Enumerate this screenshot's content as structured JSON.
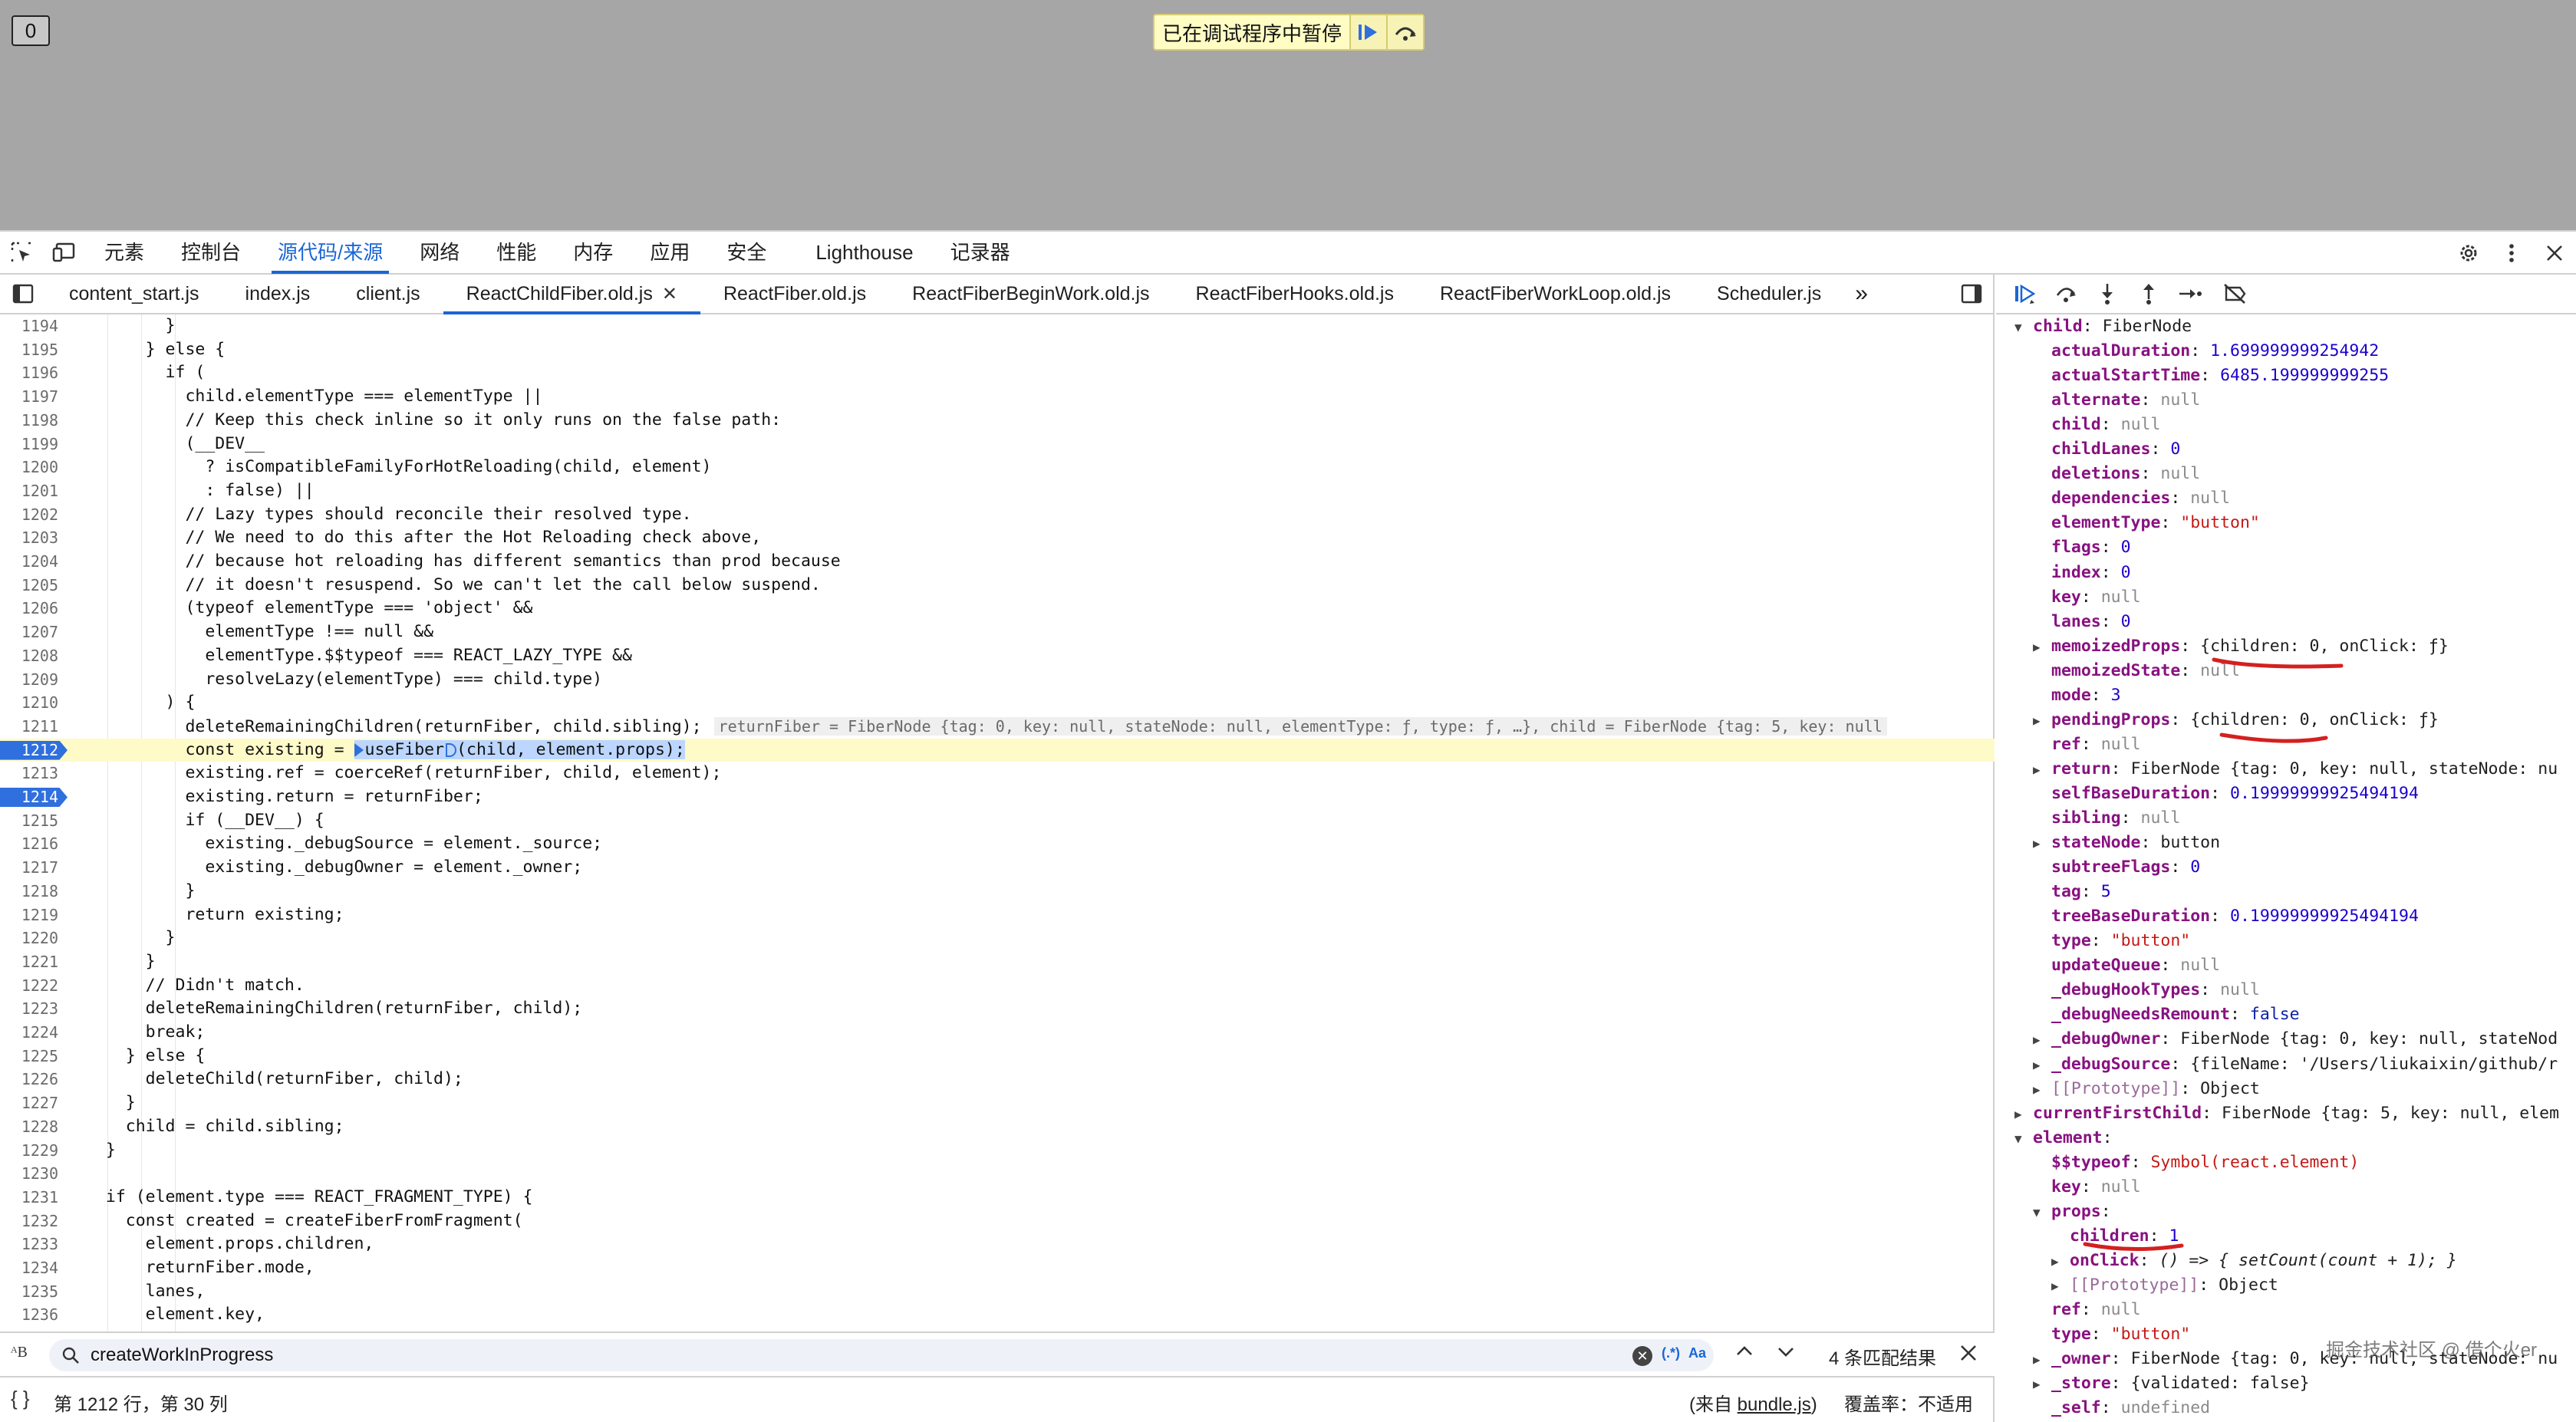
{
  "page": {
    "counter": "0",
    "paused_text": "已在调试程序中暂停"
  },
  "toolbar": {
    "tabs": [
      "元素",
      "控制台",
      "源代码/来源",
      "网络",
      "性能",
      "内存",
      "应用",
      "安全",
      "Lighthouse",
      "记录器"
    ],
    "active_tab": "源代码/来源"
  },
  "file_tabs": [
    "content_start.js",
    "index.js",
    "client.js",
    "ReactChildFiber.old.js",
    "ReactFiber.old.js",
    "ReactFiberBeginWork.old.js",
    "ReactFiberHooks.old.js",
    "ReactFiberWorkLoop.old.js",
    "Scheduler.js"
  ],
  "active_file": "ReactChildFiber.old.js",
  "code": {
    "lines": [
      {
        "n": "1194",
        "t": "        }"
      },
      {
        "n": "1195",
        "t": "      } else {"
      },
      {
        "n": "1196",
        "t": "        if ("
      },
      {
        "n": "1197",
        "t": "          child.elementType === elementType ||"
      },
      {
        "n": "1198",
        "t": "          // Keep this check inline so it only runs on the false path:"
      },
      {
        "n": "1199",
        "t": "          (__DEV__"
      },
      {
        "n": "1200",
        "t": "            ? isCompatibleFamilyForHotReloading(child, element)"
      },
      {
        "n": "1201",
        "t": "            : false) ||"
      },
      {
        "n": "1202",
        "t": "          // Lazy types should reconcile their resolved type."
      },
      {
        "n": "1203",
        "t": "          // We need to do this after the Hot Reloading check above,"
      },
      {
        "n": "1204",
        "t": "          // because hot reloading has different semantics than prod because"
      },
      {
        "n": "1205",
        "t": "          // it doesn't resuspend. So we can't let the call below suspend."
      },
      {
        "n": "1206",
        "t": "          (typeof elementType === 'object' &&"
      },
      {
        "n": "1207",
        "t": "            elementType !== null &&"
      },
      {
        "n": "1208",
        "t": "            elementType.$$typeof === REACT_LAZY_TYPE &&"
      },
      {
        "n": "1209",
        "t": "            resolveLazy(elementType) === child.type)"
      },
      {
        "n": "1210",
        "t": "        ) {"
      },
      {
        "n": "1211",
        "t": "          deleteRemainingChildren(returnFiber, child.sibling);"
      },
      {
        "n": "1212",
        "t": "          const existing = "
      },
      {
        "n": "1213",
        "t": "          existing.ref = coerceRef(returnFiber, child, element);"
      },
      {
        "n": "1214",
        "t": "          existing.return = returnFiber;"
      },
      {
        "n": "1215",
        "t": "          if (__DEV__) {"
      },
      {
        "n": "1216",
        "t": "            existing._debugSource = element._source;"
      },
      {
        "n": "1217",
        "t": "            existing._debugOwner = element._owner;"
      },
      {
        "n": "1218",
        "t": "          }"
      },
      {
        "n": "1219",
        "t": "          return existing;"
      },
      {
        "n": "1220",
        "t": "        }"
      },
      {
        "n": "1221",
        "t": "      }"
      },
      {
        "n": "1222",
        "t": "      // Didn't match."
      },
      {
        "n": "1223",
        "t": "      deleteRemainingChildren(returnFiber, child);"
      },
      {
        "n": "1224",
        "t": "      break;"
      },
      {
        "n": "1225",
        "t": "    } else {"
      },
      {
        "n": "1226",
        "t": "      deleteChild(returnFiber, child);"
      },
      {
        "n": "1227",
        "t": "    }"
      },
      {
        "n": "1228",
        "t": "    child = child.sibling;"
      },
      {
        "n": "1229",
        "t": "  }"
      },
      {
        "n": "1230",
        "t": ""
      },
      {
        "n": "1231",
        "t": "  if (element.type === REACT_FRAGMENT_TYPE) {"
      },
      {
        "n": "1232",
        "t": "    const created = createFiberFromFragment("
      },
      {
        "n": "1233",
        "t": "      element.props.children,"
      },
      {
        "n": "1234",
        "t": "      returnFiber.mode,"
      },
      {
        "n": "1235",
        "t": "      lanes,"
      },
      {
        "n": "1236",
        "t": "      element.key,"
      }
    ],
    "line_1212_rest": "useFiber",
    "line_1212_tail": "(child, element.props);",
    "inline_value_1211": "returnFiber = FiberNode {tag: 0, key: null, stateNode: null, elementType: ƒ, type: ƒ, …}, child = FiberNode {tag: 5, key: null",
    "current_line": "1212",
    "breakpoints": [
      "1212",
      "1214"
    ]
  },
  "search": {
    "value": "createWorkInProgress",
    "regex_label": "(.*)",
    "case_label": "Aa",
    "result_count": "4 条匹配结果"
  },
  "status": {
    "position": "第 1212 行，第 30 列",
    "source_prefix": "(来自 ",
    "source_file": "bundle.js",
    "source_suffix": ")",
    "coverage": "覆盖率：不适用"
  },
  "scope": {
    "rows": [
      {
        "indent": 0,
        "tri": "▼",
        "key": "child",
        "val": "FiberNode",
        "vt": "obj"
      },
      {
        "indent": 1,
        "tri": "",
        "key": "actualDuration",
        "val": "1.699999999254942",
        "vt": "num"
      },
      {
        "indent": 1,
        "tri": "",
        "key": "actualStartTime",
        "val": "6485.199999999255",
        "vt": "num"
      },
      {
        "indent": 1,
        "tri": "",
        "key": "alternate",
        "val": "null",
        "vt": "null"
      },
      {
        "indent": 1,
        "tri": "",
        "key": "child",
        "val": "null",
        "vt": "null"
      },
      {
        "indent": 1,
        "tri": "",
        "key": "childLanes",
        "val": "0",
        "vt": "num"
      },
      {
        "indent": 1,
        "tri": "",
        "key": "deletions",
        "val": "null",
        "vt": "null"
      },
      {
        "indent": 1,
        "tri": "",
        "key": "dependencies",
        "val": "null",
        "vt": "null"
      },
      {
        "indent": 1,
        "tri": "",
        "key": "elementType",
        "val": "\"button\"",
        "vt": "str"
      },
      {
        "indent": 1,
        "tri": "",
        "key": "flags",
        "val": "0",
        "vt": "num"
      },
      {
        "indent": 1,
        "tri": "",
        "key": "index",
        "val": "0",
        "vt": "num"
      },
      {
        "indent": 1,
        "tri": "",
        "key": "key",
        "val": "null",
        "vt": "null"
      },
      {
        "indent": 1,
        "tri": "",
        "key": "lanes",
        "val": "0",
        "vt": "num"
      },
      {
        "indent": 1,
        "tri": "▶",
        "key": "memoizedProps",
        "val": "{children: 0, onClick: ƒ}",
        "vt": "obj"
      },
      {
        "indent": 1,
        "tri": "",
        "key": "memoizedState",
        "val": "null",
        "vt": "null"
      },
      {
        "indent": 1,
        "tri": "",
        "key": "mode",
        "val": "3",
        "vt": "num"
      },
      {
        "indent": 1,
        "tri": "▶",
        "key": "pendingProps",
        "val": "{children: 0, onClick: ƒ}",
        "vt": "obj"
      },
      {
        "indent": 1,
        "tri": "",
        "key": "ref",
        "val": "null",
        "vt": "null"
      },
      {
        "indent": 1,
        "tri": "▶",
        "key": "return",
        "val": "FiberNode {tag: 0, key: null, stateNode: nu",
        "vt": "obj"
      },
      {
        "indent": 1,
        "tri": "",
        "key": "selfBaseDuration",
        "val": "0.19999999925494194",
        "vt": "num"
      },
      {
        "indent": 1,
        "tri": "",
        "key": "sibling",
        "val": "null",
        "vt": "null"
      },
      {
        "indent": 1,
        "tri": "▶",
        "key": "stateNode",
        "val": "button",
        "vt": "obj"
      },
      {
        "indent": 1,
        "tri": "",
        "key": "subtreeFlags",
        "val": "0",
        "vt": "num"
      },
      {
        "indent": 1,
        "tri": "",
        "key": "tag",
        "val": "5",
        "vt": "num"
      },
      {
        "indent": 1,
        "tri": "",
        "key": "treeBaseDuration",
        "val": "0.19999999925494194",
        "vt": "num"
      },
      {
        "indent": 1,
        "tri": "",
        "key": "type",
        "val": "\"button\"",
        "vt": "str"
      },
      {
        "indent": 1,
        "tri": "",
        "key": "updateQueue",
        "val": "null",
        "vt": "null"
      },
      {
        "indent": 1,
        "tri": "",
        "key": "_debugHookTypes",
        "val": "null",
        "vt": "null"
      },
      {
        "indent": 1,
        "tri": "",
        "key": "_debugNeedsRemount",
        "val": "false",
        "vt": "bool"
      },
      {
        "indent": 1,
        "tri": "▶",
        "key": "_debugOwner",
        "val": "FiberNode {tag: 0, key: null, stateNod",
        "vt": "obj"
      },
      {
        "indent": 1,
        "tri": "▶",
        "key": "_debugSource",
        "val": "{fileName: '/Users/liukaixin/github/r",
        "vt": "obj"
      },
      {
        "indent": 1,
        "tri": "▶",
        "key": "[[Prototype]]",
        "val": "Object",
        "vt": "obj",
        "dim": true
      },
      {
        "indent": 0,
        "tri": "▶",
        "key": "currentFirstChild",
        "val": "FiberNode {tag: 5, key: null, elem",
        "vt": "obj"
      },
      {
        "indent": 0,
        "tri": "▼",
        "key": "element",
        "val": "",
        "vt": "obj"
      },
      {
        "indent": 1,
        "tri": "",
        "key": "$$typeof",
        "val": "Symbol(react.element)",
        "vt": "str"
      },
      {
        "indent": 1,
        "tri": "",
        "key": "key",
        "val": "null",
        "vt": "null"
      },
      {
        "indent": 1,
        "tri": "▼",
        "key": "props",
        "val": "",
        "vt": "obj"
      },
      {
        "indent": 2,
        "tri": "",
        "key": "children",
        "val": "1",
        "vt": "num"
      },
      {
        "indent": 2,
        "tri": "▶",
        "key": "onClick",
        "val": "() => { setCount(count + 1); }",
        "vt": "fn"
      },
      {
        "indent": 2,
        "tri": "▶",
        "key": "[[Prototype]]",
        "val": "Object",
        "vt": "obj",
        "dim": true
      },
      {
        "indent": 1,
        "tri": "",
        "key": "ref",
        "val": "null",
        "vt": "null"
      },
      {
        "indent": 1,
        "tri": "",
        "key": "type",
        "val": "\"button\"",
        "vt": "str"
      },
      {
        "indent": 1,
        "tri": "▶",
        "key": "_owner",
        "val": "FiberNode {tag: 0, key: null, stateNode: nu",
        "vt": "obj"
      },
      {
        "indent": 1,
        "tri": "▶",
        "key": "_store",
        "val": "{validated: false}",
        "vt": "obj"
      },
      {
        "indent": 1,
        "tri": "",
        "key": "_self",
        "val": "undefined",
        "vt": "null"
      }
    ],
    "watermark": "掘金技术社区 @ 借个火er"
  },
  "colors": {
    "accent": "#1a66d6",
    "breakpoint": "#2f6fde",
    "current_line": "#fffbc9",
    "annotation_red": "#d42020"
  }
}
